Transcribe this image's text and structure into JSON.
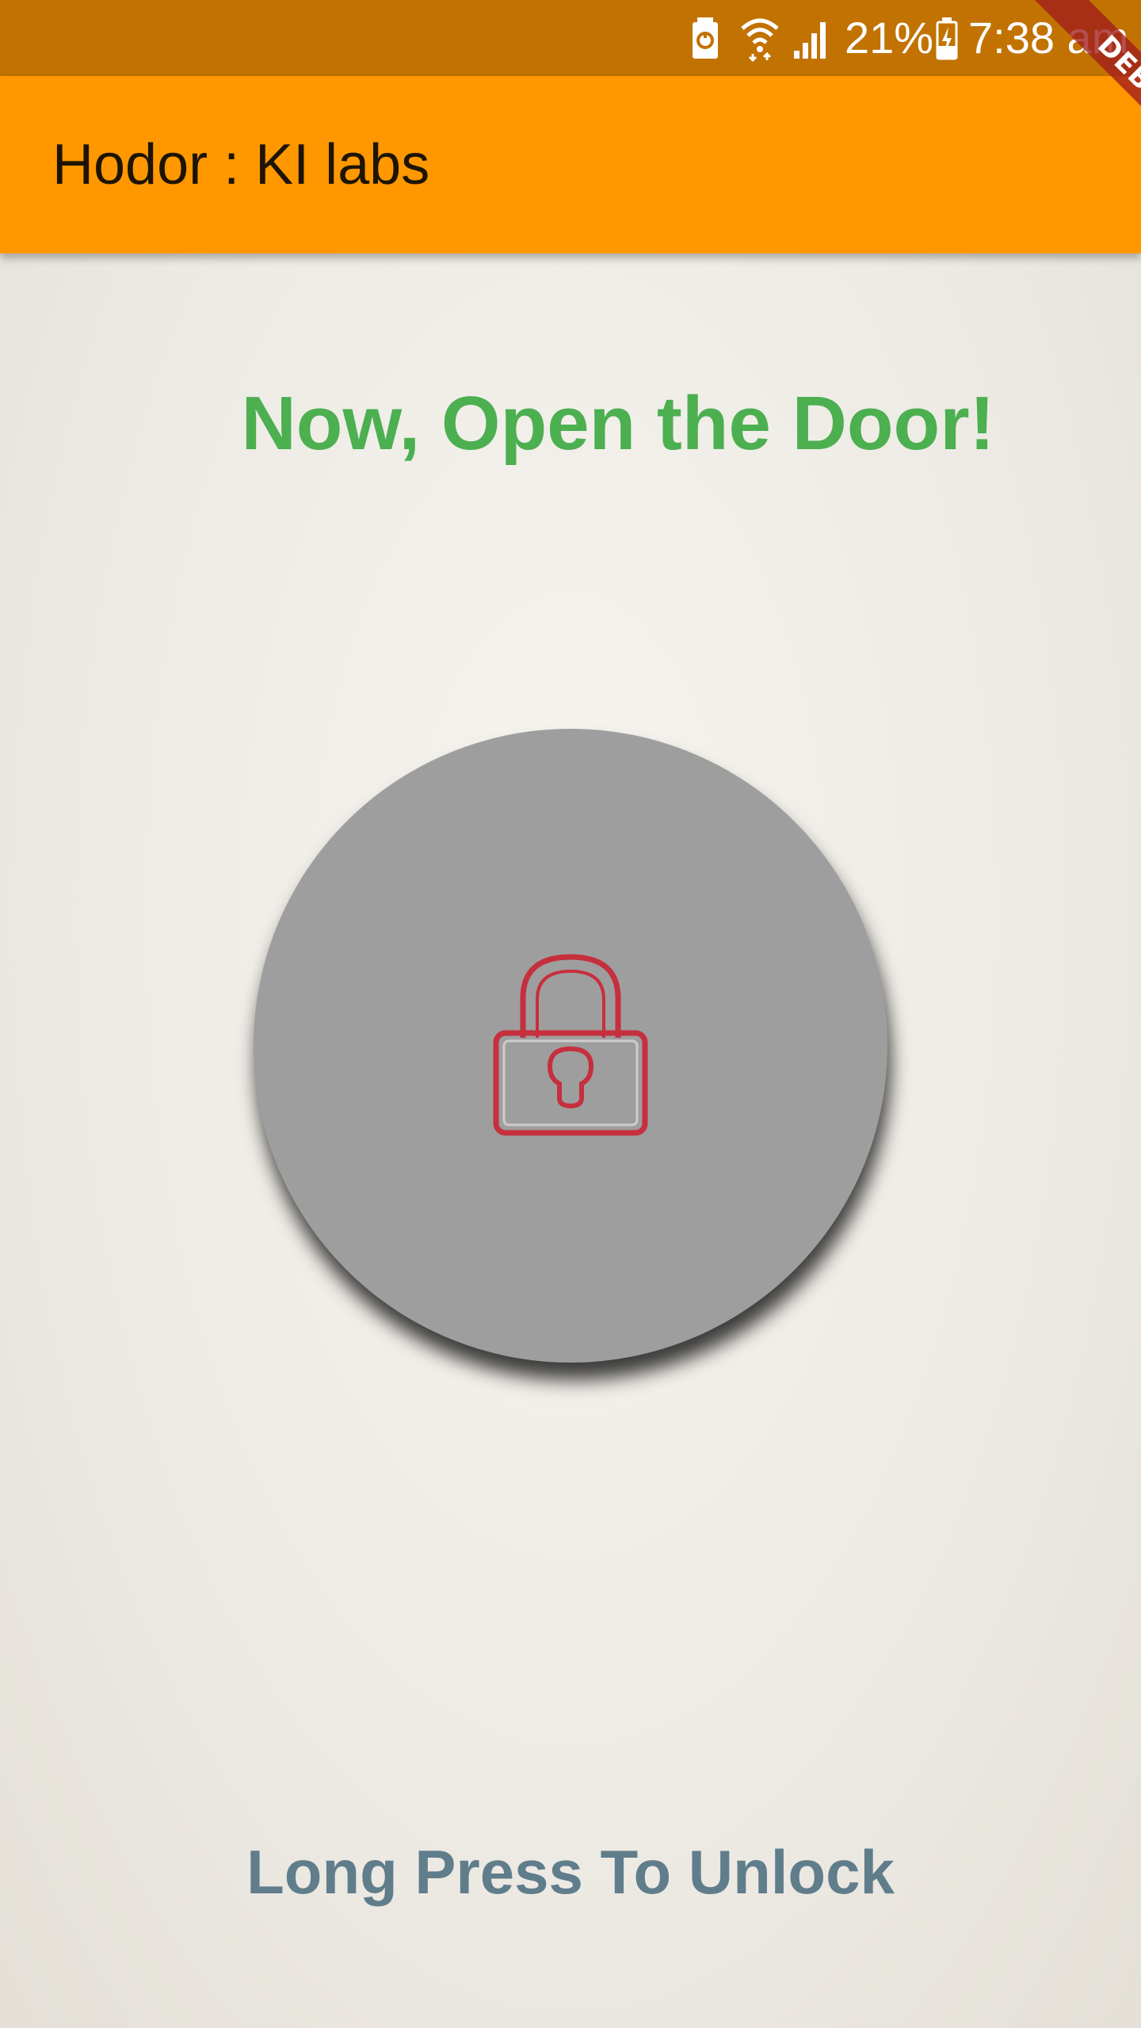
{
  "status_bar": {
    "battery_percent": "21%",
    "time": "7:38 am",
    "icons": [
      "battery-saver-icon",
      "wifi-icon",
      "signal-icon",
      "charging-battery-icon"
    ]
  },
  "app_bar": {
    "title": "Hodor : KI labs",
    "background_color": "#ff9800"
  },
  "debug_banner": {
    "label": "DEBUG"
  },
  "main": {
    "heading": "Now, Open the Door!",
    "heading_color": "#4caf50",
    "lock_button": {
      "icon": "padlock-icon",
      "icon_color": "#c62f3d",
      "background_color": "#9e9e9e"
    },
    "footer_text": "Long Press To Unlock",
    "footer_color": "#607d8b"
  }
}
